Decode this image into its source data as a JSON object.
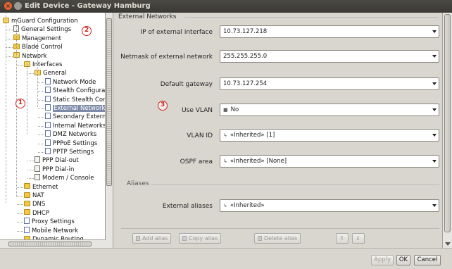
{
  "window": {
    "title": "Edit Device - Gateway Hamburg"
  },
  "tree": {
    "items": [
      {
        "label": "mGuard Configuration",
        "indent": 0,
        "icon": "folder-open"
      },
      {
        "label": "General Settings",
        "indent": 1,
        "icon": "doc"
      },
      {
        "label": "Management",
        "indent": 1,
        "icon": "folder"
      },
      {
        "label": "Blade Control",
        "indent": 1,
        "icon": "folder"
      },
      {
        "label": "Network",
        "indent": 1,
        "icon": "folder-open"
      },
      {
        "label": "Interfaces",
        "indent": 2,
        "icon": "folder-open"
      },
      {
        "label": "General",
        "indent": 3,
        "icon": "folder-open"
      },
      {
        "label": "Network Mode",
        "indent": 4,
        "icon": "doc-blue"
      },
      {
        "label": "Stealth Configuration",
        "indent": 4,
        "icon": "doc-blue"
      },
      {
        "label": "Static Stealth Config",
        "indent": 4,
        "icon": "doc-blue"
      },
      {
        "label": "External Networks",
        "indent": 4,
        "icon": "doc-blue",
        "selected": true
      },
      {
        "label": "Secondary External",
        "indent": 4,
        "icon": "doc-blue"
      },
      {
        "label": "Internal Networks",
        "indent": 4,
        "icon": "doc-blue"
      },
      {
        "label": "DMZ Networks",
        "indent": 4,
        "icon": "doc-blue"
      },
      {
        "label": "PPPoE Settings",
        "indent": 4,
        "icon": "doc-blue"
      },
      {
        "label": "PPTP Settings",
        "indent": 4,
        "icon": "doc-blue"
      },
      {
        "label": "PPP Dial-out",
        "indent": 3,
        "icon": "doc"
      },
      {
        "label": "PPP Dial-in",
        "indent": 3,
        "icon": "doc"
      },
      {
        "label": "Modem / Console",
        "indent": 3,
        "icon": "doc"
      },
      {
        "label": "Ethernet",
        "indent": 2,
        "icon": "folder"
      },
      {
        "label": "NAT",
        "indent": 2,
        "icon": "folder"
      },
      {
        "label": "DNS",
        "indent": 2,
        "icon": "folder"
      },
      {
        "label": "DHCP",
        "indent": 2,
        "icon": "folder"
      },
      {
        "label": "Proxy Settings",
        "indent": 2,
        "icon": "doc-blue"
      },
      {
        "label": "Mobile Network",
        "indent": 2,
        "icon": "doc-blue"
      },
      {
        "label": "Dynamic Routing",
        "indent": 2,
        "icon": "folder"
      }
    ]
  },
  "section": {
    "title": "External Networks"
  },
  "fields": {
    "ip": {
      "label": "IP of external interface",
      "value": "10.73.127.218"
    },
    "netmask": {
      "label": "Netmask of external network",
      "value": "255.255.255.0"
    },
    "gateway": {
      "label": "Default gateway",
      "value": "10.73.127.254"
    },
    "vlan": {
      "label": "Use VLAN",
      "value": "No"
    },
    "vlan_id": {
      "label": "VLAN ID",
      "value": "«Inherited» [1]"
    },
    "ospf": {
      "label": "OSPF area",
      "value": "«Inherited» [None]"
    }
  },
  "aliases": {
    "title": "Aliases",
    "external_label": "External aliases",
    "external_value": "«Inherited»",
    "buttons": {
      "add": "Add alias",
      "copy": "Copy alias",
      "delete": "Delete alias"
    }
  },
  "dialog_buttons": {
    "apply": "Apply",
    "ok": "OK",
    "cancel": "Cancel"
  },
  "callouts": {
    "one": "1",
    "two": "2",
    "three": "3"
  },
  "colors": {
    "callout": "#d0201b",
    "selection": "#7d8aa8",
    "titlebar": "#3a3935"
  }
}
